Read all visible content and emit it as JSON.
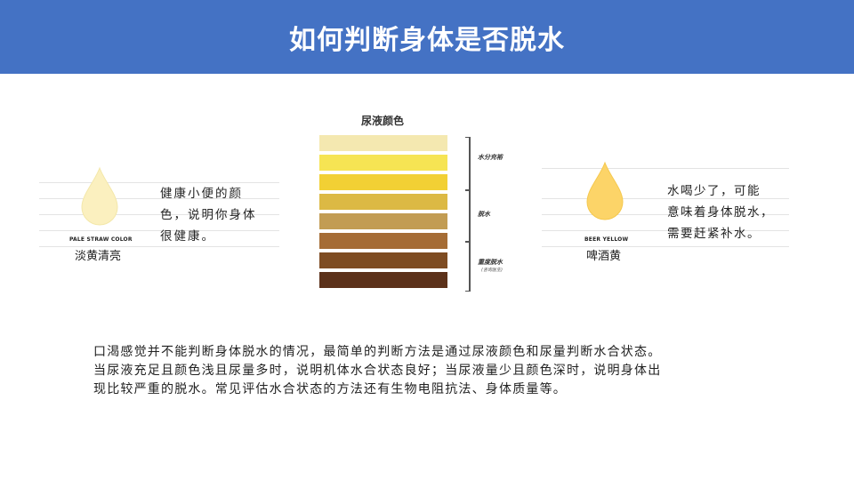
{
  "header": {
    "title": "如何判断身体是否脱水",
    "bg_color": "#4472c4"
  },
  "left_card": {
    "en_caption": "PALE STRAW COLOR",
    "cn_caption": "淡黄清亮",
    "description_lines": [
      "健康小便的颜",
      "色，说明你身体",
      "很健康。"
    ],
    "drop_color": "#fbf0bf"
  },
  "right_card": {
    "en_caption": "BEER YELLOW",
    "cn_caption": "啤酒黄",
    "description_lines": [
      "水喝少了，可能",
      "意味着身体脱水，",
      "需要赶紧补水。"
    ],
    "drop_color": "#fcd468"
  },
  "color_chart": {
    "title": "尿液颜色",
    "swatches": [
      "#f4e8b0",
      "#f6e453",
      "#f2d034",
      "#dcb944",
      "#c29c53",
      "#a56c35",
      "#7e4c22",
      "#5c311a"
    ],
    "groups": [
      {
        "label": "水分充裕",
        "sub": ""
      },
      {
        "label": "脱水",
        "sub": ""
      },
      {
        "label": "重度脱水",
        "sub": "(咨询医生)"
      }
    ]
  },
  "paragraph": {
    "lines": [
      "口渴感觉并不能判断身体脱水的情况，最简单的判断方法是通过尿液颜色和尿量判断水合状态。",
      "当尿液充足且颜色浅且尿量多时，说明机体水合状态良好；当尿液量少且颜色深时，说明身体出",
      "现比较严重的脱水。常见评估水合状态的方法还有生物电阻抗法、身体质量等。"
    ]
  }
}
